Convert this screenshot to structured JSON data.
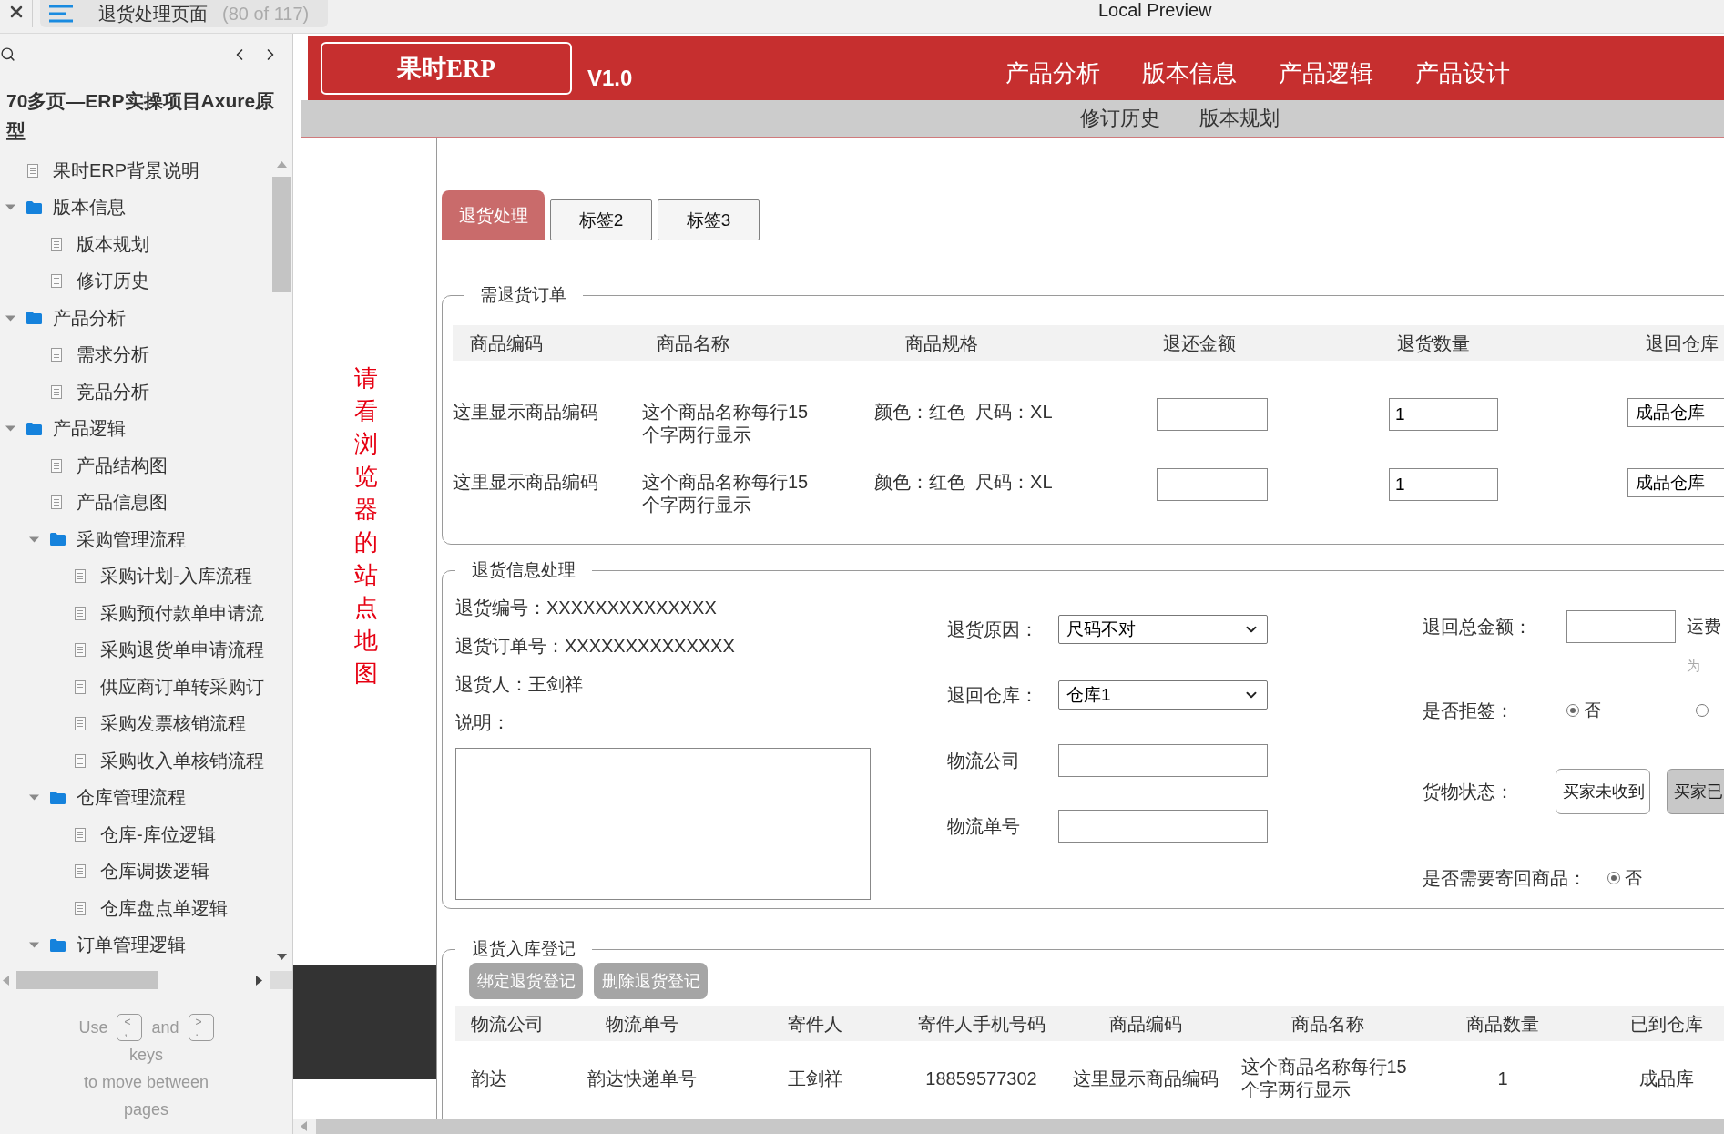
{
  "top_bar": {
    "page_title": "退货处理页面",
    "page_count": "(80 of 117)",
    "preview_title": "Local Preview"
  },
  "sitemap": {
    "project_title": "70多页—ERP实操项目Axure原型",
    "items": [
      {
        "label": "果时ERP背景说明",
        "kind": "page"
      },
      {
        "label": "版本信息",
        "kind": "folder",
        "expanded": true,
        "children": [
          {
            "label": "版本规划",
            "kind": "page"
          },
          {
            "label": "修订历史",
            "kind": "page"
          }
        ]
      },
      {
        "label": "产品分析",
        "kind": "folder",
        "expanded": true,
        "children": [
          {
            "label": "需求分析",
            "kind": "page"
          },
          {
            "label": "竞品分析",
            "kind": "page"
          }
        ]
      },
      {
        "label": "产品逻辑",
        "kind": "folder",
        "expanded": true,
        "children": [
          {
            "label": "产品结构图",
            "kind": "page"
          },
          {
            "label": "产品信息图",
            "kind": "page"
          },
          {
            "label": "采购管理流程",
            "kind": "folder",
            "expanded": true,
            "children": [
              {
                "label": "采购计划-入库流程",
                "kind": "page"
              },
              {
                "label": "采购预付款单申请流",
                "kind": "page"
              },
              {
                "label": "采购退货单申请流程",
                "kind": "page"
              },
              {
                "label": "供应商订单转采购订",
                "kind": "page"
              },
              {
                "label": "采购发票核销流程",
                "kind": "page"
              },
              {
                "label": "采购收入单核销流程",
                "kind": "page"
              }
            ]
          },
          {
            "label": "仓库管理流程",
            "kind": "folder",
            "expanded": true,
            "children": [
              {
                "label": "仓库-库位逻辑",
                "kind": "page"
              },
              {
                "label": "仓库调拨逻辑",
                "kind": "page"
              },
              {
                "label": "仓库盘点单逻辑",
                "kind": "page"
              }
            ]
          },
          {
            "label": "订单管理逻辑",
            "kind": "folder",
            "expanded": true
          }
        ]
      }
    ],
    "hint": {
      "before": "Use",
      "between": "and",
      "keys": [
        {
          "top": "<",
          "bottom": ","
        },
        {
          "top": ">",
          "bottom": "."
        }
      ],
      "after_lines": [
        "keys",
        "to move between",
        "pages"
      ]
    }
  },
  "header": {
    "logo": "果时ERP",
    "version": "V1.0",
    "nav": [
      {
        "label": "产品分析"
      },
      {
        "label": "版本信息"
      },
      {
        "label": "产品逻辑"
      },
      {
        "label": "产品设计"
      }
    ],
    "subnav": [
      {
        "label": "修订历史"
      },
      {
        "label": "版本规划"
      }
    ]
  },
  "side_note": "请看浏览器的站点地图",
  "tabs": [
    {
      "label": "退货处理",
      "selected": true
    },
    {
      "label": "标签2",
      "selected": false
    },
    {
      "label": "标签3",
      "selected": false
    }
  ],
  "return_order": {
    "legend": "需退货订单",
    "columns": [
      "商品编码",
      "商品名称",
      "商品规格",
      "退还金额",
      "退货数量",
      "退回仓库"
    ],
    "rows": [
      {
        "code": "这里显示商品编码",
        "name": "这个商品名称每行15个字两行显示",
        "spec": "颜色：红色  尺码：XL",
        "quantity": "1",
        "warehouse": "成品仓库"
      },
      {
        "code": "这里显示商品编码",
        "name": "这个商品名称每行15个字两行显示",
        "spec": "颜色：红色  尺码：XL",
        "quantity": "1",
        "warehouse": "成品仓库"
      }
    ]
  },
  "return_info": {
    "legend": "退货信息处理",
    "details": [
      "退货编号：XXXXXXXXXXXXXX",
      "退货订单号：XXXXXXXXXXXXXX",
      "退货人：王剑祥"
    ],
    "note_label": "说明：",
    "fields": [
      {
        "kind": "select",
        "label": "退货原因：",
        "value": "尺码不对"
      },
      {
        "kind": "select",
        "label": "退回仓库：",
        "value": "仓库1"
      },
      {
        "kind": "input",
        "label": "物流公司"
      },
      {
        "kind": "input",
        "label": "物流单号"
      }
    ],
    "total": {
      "label": "退回总金额：",
      "suffix": "运费",
      "hint": "为"
    },
    "rejected": {
      "label": "是否拒签：",
      "options": [
        {
          "label": "否",
          "selected": true
        },
        {
          "selected": false
        }
      ]
    },
    "goods_status": {
      "label": "货物状态：",
      "options": [
        {
          "label": "买家未收到",
          "selected": false
        },
        {
          "label": "买家已",
          "selected": true
        }
      ]
    },
    "send_back": {
      "label": "是否需要寄回商品：",
      "options": [
        {
          "label": "否",
          "selected": true
        }
      ]
    }
  },
  "inbound_register": {
    "legend": "退货入库登记",
    "buttons": [
      {
        "label": "绑定退货登记"
      },
      {
        "label": "删除退货登记"
      }
    ],
    "columns": [
      "物流公司",
      "物流单号",
      "寄件人",
      "寄件人手机号码",
      "商品编码",
      "商品名称",
      "商品数量",
      "已到仓库"
    ],
    "rows": [
      {
        "cells": [
          "韵达",
          "韵达快递单号",
          "王剑祥",
          "18859577302",
          "这里显示商品编码",
          "这个商品名称每行15个字两行显示",
          "1",
          "成品库"
        ]
      }
    ]
  }
}
